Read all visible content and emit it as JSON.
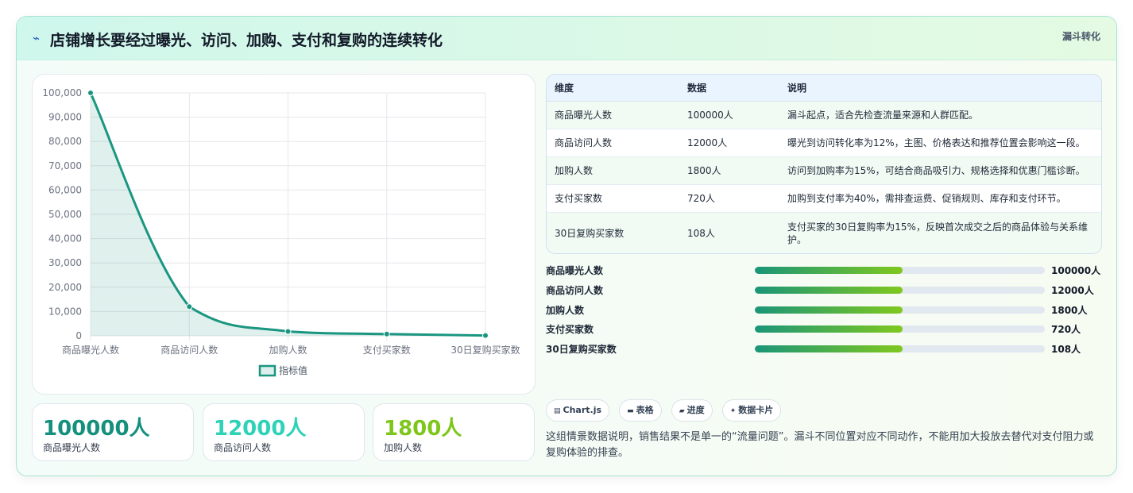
{
  "header": {
    "icon": "lightning-icon",
    "title": "店铺增长要经过曝光、访问、加购、支付和复购的连续转化",
    "tag": "漏斗转化"
  },
  "chart_data": {
    "type": "line",
    "categories": [
      "商品曝光人数",
      "商品访问人数",
      "加购人数",
      "支付买家数",
      "30日复购买家数"
    ],
    "series": [
      {
        "name": "指标值",
        "values": [
          100000,
          12000,
          1800,
          720,
          108
        ]
      }
    ],
    "yticks": [
      "0",
      "10,000",
      "20,000",
      "30,000",
      "40,000",
      "50,000",
      "60,000",
      "70,000",
      "80,000",
      "90,000",
      "100,000"
    ],
    "ylim": [
      0,
      100000
    ],
    "legend": "bottom",
    "grid": true,
    "fill": true,
    "color": "#1a9680"
  },
  "stats": [
    {
      "value": "100000人",
      "label": "商品曝光人数",
      "color": "#14907c"
    },
    {
      "value": "12000人",
      "label": "商品访问人数",
      "color": "#2ed3b7"
    },
    {
      "value": "1800人",
      "label": "加购人数",
      "color": "#7ec61b"
    }
  ],
  "table": {
    "headers": [
      "维度",
      "数据",
      "说明"
    ],
    "rows": [
      [
        "商品曝光人数",
        "100000人",
        "漏斗起点，适合先检查流量来源和人群匹配。"
      ],
      [
        "商品访问人数",
        "12000人",
        "曝光到访问转化率为12%，主图、价格表达和推荐位置会影响这一段。"
      ],
      [
        "加购人数",
        "1800人",
        "访问到加购率为15%，可结合商品吸引力、规格选择和优惠门槛诊断。"
      ],
      [
        "支付买家数",
        "720人",
        "加购到支付率为40%，需排查运费、促销规则、库存和支付环节。"
      ],
      [
        "30日复购买家数",
        "108人",
        "支付买家的30日复购率为15%，反映首次成交之后的商品体验与关系维护。"
      ]
    ]
  },
  "bars": [
    {
      "label": "商品曝光人数",
      "value": "100000人",
      "fill": 0.51
    },
    {
      "label": "商品访问人数",
      "value": "12000人",
      "fill": 0.51
    },
    {
      "label": "加购人数",
      "value": "1800人",
      "fill": 0.51
    },
    {
      "label": "支付买家数",
      "value": "720人",
      "fill": 0.51
    },
    {
      "label": "30日复购买家数",
      "value": "108人",
      "fill": 0.51
    }
  ],
  "chips": [
    {
      "icon": "chart-icon",
      "glyph": "▤",
      "label": "Chart.js"
    },
    {
      "icon": "table-icon",
      "glyph": "▬",
      "label": "表格"
    },
    {
      "icon": "folder-icon",
      "glyph": "▰",
      "label": "进度"
    },
    {
      "icon": "sparkle-icon",
      "glyph": "✦",
      "label": "数据卡片"
    }
  ],
  "description": "这组情景数据说明，销售结果不是单一的“流量问题”。漏斗不同位置对应不同动作，不能用加大投放去替代对支付阻力或复购体验的排查。"
}
